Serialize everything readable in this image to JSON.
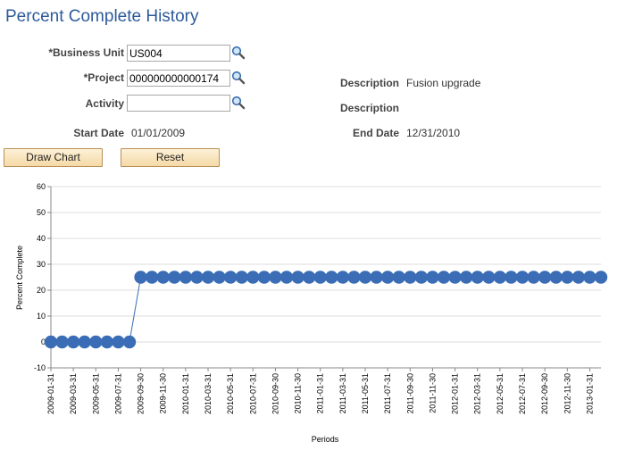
{
  "page": {
    "title": "Percent Complete History"
  },
  "form": {
    "business_unit": {
      "label": "*Business Unit",
      "value": "US004"
    },
    "project": {
      "label": "*Project",
      "value": "000000000000174"
    },
    "activity": {
      "label": "Activity",
      "value": ""
    },
    "description1": {
      "label": "Description",
      "value": "Fusion upgrade"
    },
    "description2": {
      "label": "Description",
      "value": ""
    },
    "start_date": {
      "label": "Start Date",
      "value": "01/01/2009"
    },
    "end_date": {
      "label": "End Date",
      "value": "12/31/2010"
    }
  },
  "buttons": {
    "draw_chart": "Draw Chart",
    "reset": "Reset"
  },
  "icons": {
    "lookup": "magnifier-icon"
  },
  "colors": {
    "title": "#2d5a9b",
    "series": "#3a6db5",
    "button_bg": "#f5d9a6"
  },
  "chart_data": {
    "type": "line",
    "xlabel": "Periods",
    "ylabel": "Percent Complete",
    "ylim": [
      -10,
      60
    ],
    "yticks": [
      -10,
      0,
      10,
      20,
      30,
      40,
      50,
      60
    ],
    "grid": true,
    "x": [
      "2009-01-31",
      "2009-02-28",
      "2009-03-31",
      "2009-04-30",
      "2009-05-31",
      "2009-06-30",
      "2009-07-31",
      "2009-08-31",
      "2009-09-30",
      "2009-10-31",
      "2009-11-30",
      "2009-12-31",
      "2010-01-31",
      "2010-02-28",
      "2010-03-31",
      "2010-04-30",
      "2010-05-31",
      "2010-06-30",
      "2010-07-31",
      "2010-08-31",
      "2010-09-30",
      "2010-10-31",
      "2010-11-30",
      "2010-12-31",
      "2011-01-31",
      "2011-02-28",
      "2011-03-31",
      "2011-04-30",
      "2011-05-31",
      "2011-06-30",
      "2011-07-31",
      "2011-08-31",
      "2011-09-30",
      "2011-10-31",
      "2011-11-30",
      "2011-12-31",
      "2012-01-31",
      "2012-02-29",
      "2012-03-31",
      "2012-04-30",
      "2012-05-31",
      "2012-06-30",
      "2012-07-31",
      "2012-08-31",
      "2012-09-30",
      "2012-10-31",
      "2012-11-30",
      "2012-12-31",
      "2013-01-31",
      "2013-02-28"
    ],
    "tick_labels": [
      "2009-01-31",
      "2009-03-31",
      "2009-05-31",
      "2009-07-31",
      "2009-09-30",
      "2009-11-30",
      "2010-01-31",
      "2010-03-31",
      "2010-05-31",
      "2010-07-31",
      "2010-09-30",
      "2010-11-30",
      "2011-01-31",
      "2011-03-31",
      "2011-05-31",
      "2011-07-31",
      "2011-09-30",
      "2011-11-30",
      "2012-01-31",
      "2012-03-31",
      "2012-05-31",
      "2012-07-31",
      "2012-09-30",
      "2012-11-30",
      "2013-01-31"
    ],
    "series": [
      {
        "values": [
          0,
          0,
          0,
          0,
          0,
          0,
          0,
          0,
          25,
          25,
          25,
          25,
          25,
          25,
          25,
          25,
          25,
          25,
          25,
          25,
          25,
          25,
          25,
          25,
          25,
          25,
          25,
          25,
          25,
          25,
          25,
          25,
          25,
          25,
          25,
          25,
          25,
          25,
          25,
          25,
          25,
          25,
          25,
          25,
          25,
          25,
          25,
          25,
          25,
          25
        ]
      }
    ]
  }
}
